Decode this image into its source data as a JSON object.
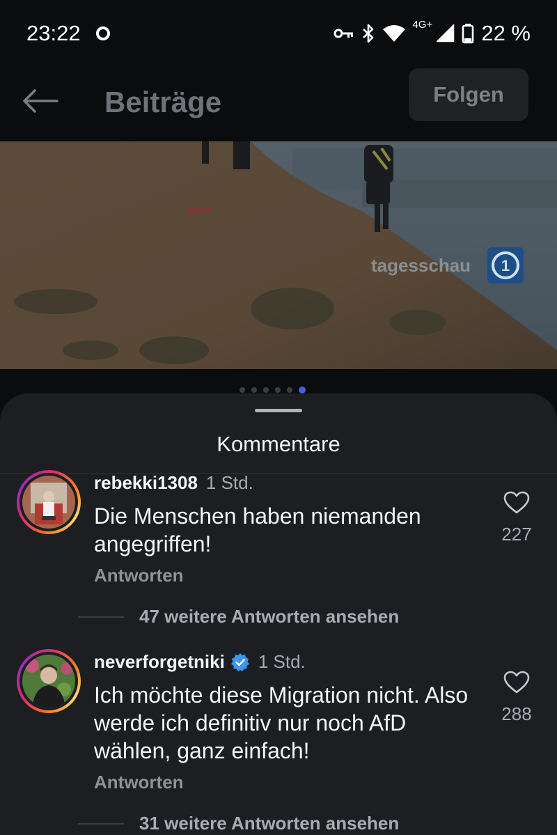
{
  "status_bar": {
    "time": "23:22",
    "network": "4G+",
    "battery": "22 %",
    "icons": [
      "vpn-key-icon",
      "bluetooth-icon",
      "wifi-icon",
      "signal-icon",
      "battery-icon"
    ]
  },
  "header": {
    "title": "Beiträge",
    "follow_label": "Folgen"
  },
  "post": {
    "watermark": "tagesschau",
    "carousel": {
      "total": 6,
      "active_index": 5
    }
  },
  "comments_sheet": {
    "title": "Kommentare",
    "comments": [
      {
        "username": "rebekki1308",
        "verified": false,
        "time": "1 Std.",
        "text": "Die Menschen haben niemanden angegriffen!",
        "reply_label": "Antworten",
        "likes": "227",
        "more_replies": "47 weitere Antworten ansehen"
      },
      {
        "username": "neverforgetniki",
        "verified": true,
        "time": "1 Std.",
        "text": "Ich möchte diese Migration nicht. Also werde ich definitiv nur noch AfD wählen, ganz einfach!",
        "reply_label": "Antworten",
        "likes": "288",
        "more_replies": "31 weitere Antworten ansehen"
      }
    ]
  },
  "colors": {
    "background": "#0b0c0e",
    "sheet": "#1c1e22",
    "verified_badge": "#3897f0",
    "carousel_active": "#3d63dd"
  }
}
